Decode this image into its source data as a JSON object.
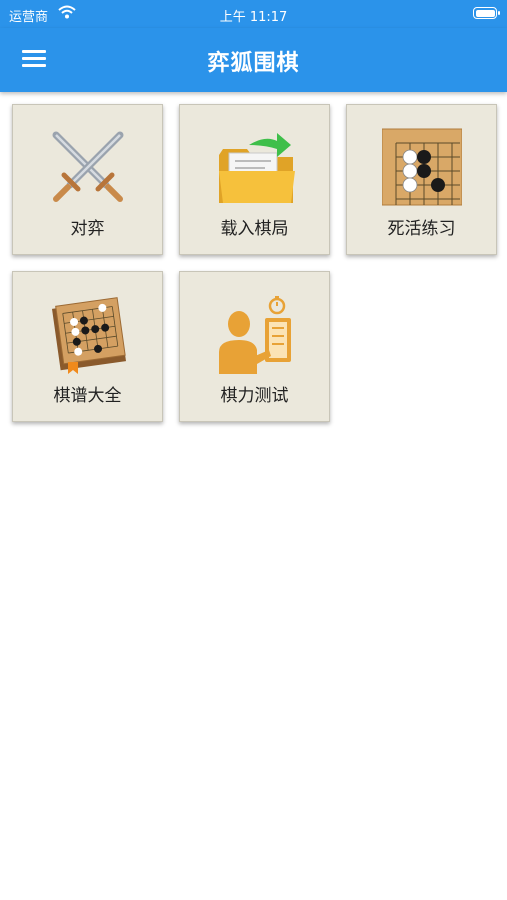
{
  "status_bar": {
    "carrier": "运营商",
    "time": "上午 11:17"
  },
  "app_bar": {
    "title": "弈狐围棋",
    "menu_icon": "hamburger-menu-icon"
  },
  "menu_tiles": [
    {
      "label": "对弈",
      "icon": "crossed-swords-icon"
    },
    {
      "label": "载入棋局",
      "icon": "folder-import-icon"
    },
    {
      "label": "死活练习",
      "icon": "go-board-corner-icon"
    },
    {
      "label": "棋谱大全",
      "icon": "go-book-icon"
    },
    {
      "label": "棋力测试",
      "icon": "player-test-icon"
    }
  ],
  "colors": {
    "primary": "#2b93ea",
    "tile_bg": "#ebe8dc"
  }
}
